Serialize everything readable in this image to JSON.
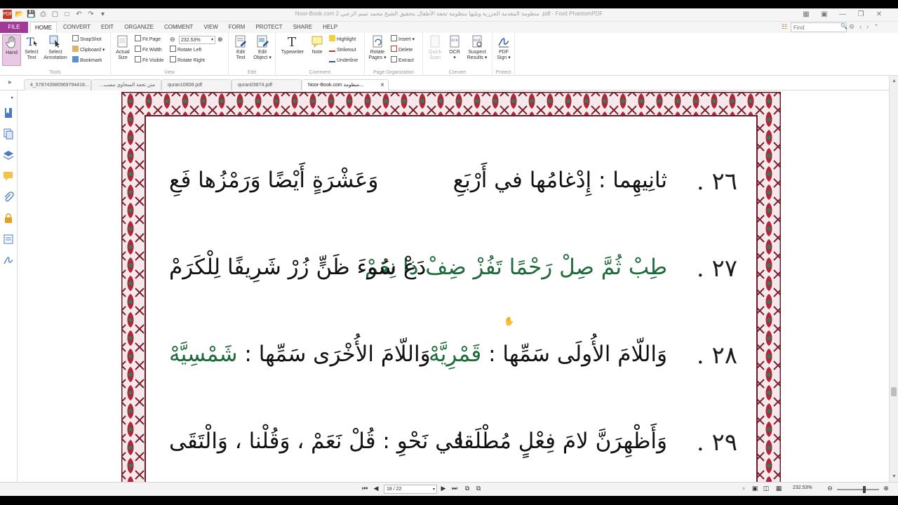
{
  "window": {
    "title": "Noor-Book.com  منظومة المقدمة الجزرية ويليها منظومة تحفة الأطفال بتحقيق الشيخ محمد تميم الزعبي 2 .pdf - Foxit PhantomPDF",
    "app_icon_label": "PDF"
  },
  "menu": {
    "file": "FILE",
    "tabs": [
      "HOME",
      "CONVERT",
      "EDIT",
      "ORGANIZE",
      "COMMENT",
      "VIEW",
      "FORM",
      "PROTECT",
      "SHARE",
      "HELP"
    ],
    "active_tab": "HOME",
    "find_placeholder": "Find"
  },
  "ribbon": {
    "tools": {
      "label": "Tools",
      "hand": "Hand",
      "select_text": [
        "Select",
        "Text"
      ],
      "select_annotation": [
        "Select",
        "Annotation"
      ],
      "snapshot": "SnapShot",
      "clipboard": "Clipboard",
      "bookmark": "Bookmark"
    },
    "view": {
      "label": "View",
      "actual_size": [
        "Actual",
        "Size"
      ],
      "fit_page": "Fit Page",
      "fit_width": "Fit Width",
      "fit_visible": "Fit Visible",
      "zoom_value": "232.53%",
      "rotate_left": "Rotate Left",
      "rotate_right": "Rotate Right"
    },
    "edit": {
      "label": "Edit",
      "edit_text": [
        "Edit",
        "Text"
      ],
      "edit_object": [
        "Edit",
        "Object"
      ]
    },
    "comment": {
      "label": "Comment",
      "typewriter": "Typewriter",
      "note": "Note",
      "highlight": "Highlight",
      "strikeout": "Strikeout",
      "underline": "Underline"
    },
    "page_org": {
      "label": "Page Organization",
      "rotate_pages": [
        "Rotate",
        "Pages"
      ],
      "insert": "Insert",
      "delete": "Delete",
      "extract": "Extract"
    },
    "convert": {
      "label": "Convert",
      "quick_scan": [
        "Quick",
        "Scan"
      ],
      "ocr": "OCR",
      "suspect_results": [
        "Suspect",
        "Results"
      ]
    },
    "protect": {
      "label": "Protect",
      "pdf_sign": [
        "PDF",
        "Sign"
      ]
    }
  },
  "doc_tabs": [
    {
      "label": "4_578743980969794418...",
      "active": false
    },
    {
      "label": "متن تحفة السخاوي مصب...",
      "active": false
    },
    {
      "label": "quran10808.pdf",
      "active": false
    },
    {
      "label": "quran03874.pdf",
      "active": false
    },
    {
      "label": "Noor-Book.com  منظومة...",
      "active": true
    }
  ],
  "verses": [
    {
      "num": "٢٦ .",
      "first": "ثانِيهِما : إِدْغامُها في أَرْبَعِ",
      "second": "وَعَشْرَةٍ أَيْضًا وَرَمْزُها فَعِ"
    },
    {
      "num": "٢٧ .",
      "first": "طِبْ ثُمَّ صِلْ رَحْمًا تَفُزْ ضِفْ ذا نِعَمْ",
      "second": "دَعْ سُوءَ ظَنٍّ زُرْ شَرِيفًا لِلْكَرَمْ"
    },
    {
      "num": "٢٨ .",
      "first_plain": "وَاللّامَ الأُولَى سَمِّها :",
      "first_green": "قَمْرِيَّهْ",
      "second_plain": "وَاللّامَ الأُخْرَى سَمِّها :",
      "second_green": "شَمْسِيَّهْ"
    },
    {
      "num": "٢٩ .",
      "first": "وَأَظْهِرَنَّ لامَ فِعْلٍ مُطْلَقا",
      "second": "في نَحْوِ : قُلْ نَعَمْ ، وَقُلْنا ، وَالْتَقَى"
    }
  ],
  "statusbar": {
    "page_display": "18 / 22",
    "zoom_value": "232.53%"
  },
  "colors": {
    "accent": "#a13a96",
    "verse_green": "#1e6b3a",
    "border_red": "#b0263a"
  }
}
